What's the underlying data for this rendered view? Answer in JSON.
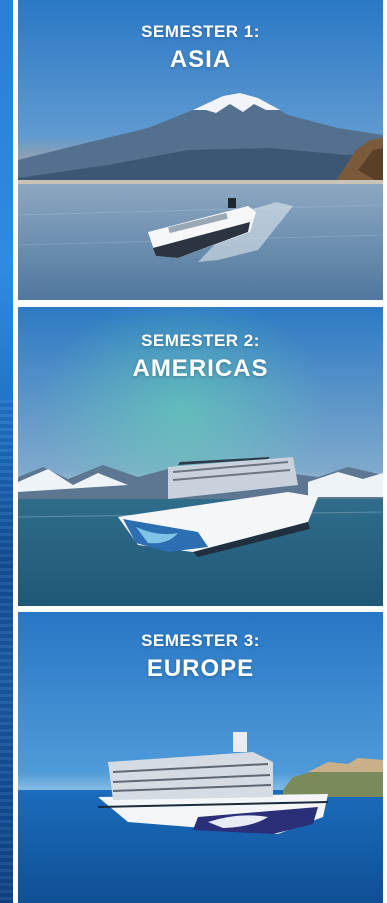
{
  "semesters": [
    {
      "label": "SEMESTER 1:",
      "destination": "ASIA"
    },
    {
      "label": "SEMESTER 2:",
      "destination": "AMERICAS"
    },
    {
      "label": "SEMESTER 3:",
      "destination": "EUROPE"
    }
  ],
  "colors": {
    "sky_blue": "#2f86d6",
    "ocean_blue": "#1565b8",
    "text": "#ffffff"
  }
}
